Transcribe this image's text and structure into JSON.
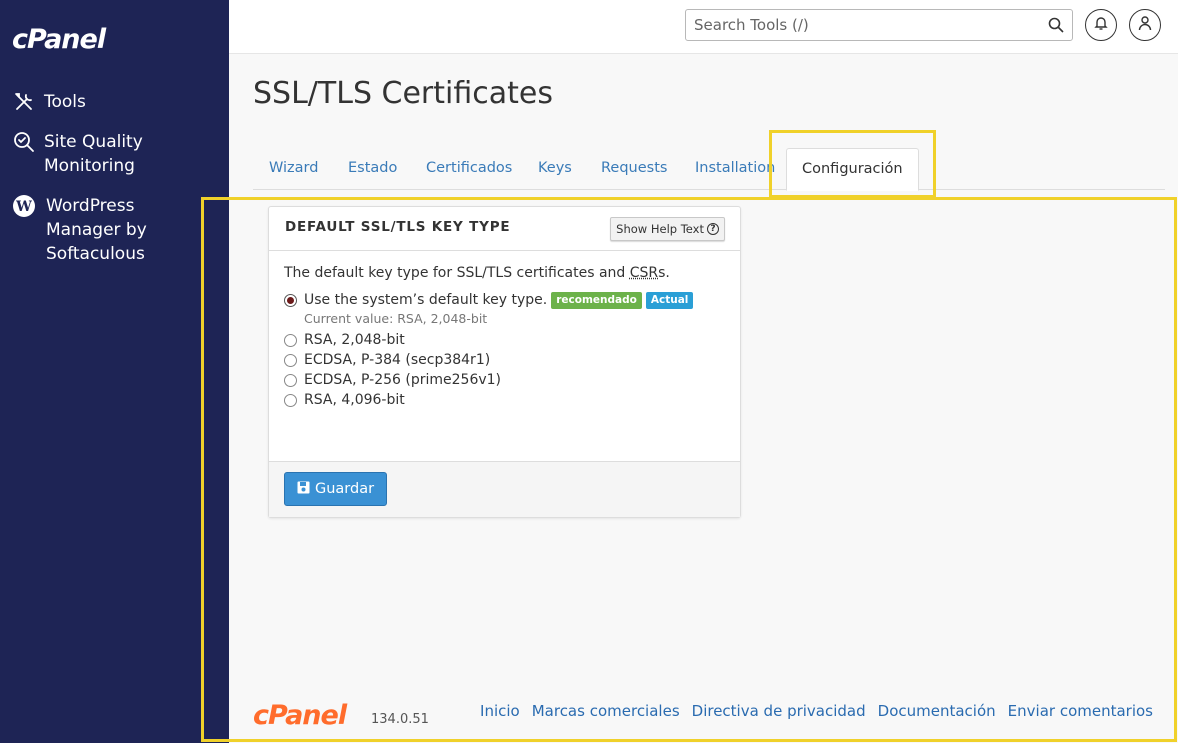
{
  "brand": {
    "logo_text": "cPanel",
    "accent": "#ff6c2c",
    "sidebar_bg": "#1e2455"
  },
  "sidebar": {
    "items": [
      {
        "label": "Tools",
        "icon": "tools-icon"
      },
      {
        "label": "Site Quality Monitoring",
        "icon": "site-quality-icon"
      },
      {
        "label": "WordPress Manager by Softaculous",
        "icon": "wordpress-icon"
      }
    ]
  },
  "header": {
    "search_placeholder": "Search Tools (/)",
    "icons": [
      "search-icon",
      "bell-icon",
      "user-icon"
    ]
  },
  "main": {
    "title": "SSL/TLS Certificates",
    "tabs": [
      {
        "label": "Wizard",
        "active": false
      },
      {
        "label": "Estado",
        "active": false
      },
      {
        "label": "Certificados",
        "active": false
      },
      {
        "label": "Keys",
        "active": false
      },
      {
        "label": "Requests",
        "active": false
      },
      {
        "label": "Installation",
        "active": false
      },
      {
        "label": "Configuración",
        "active": true
      }
    ]
  },
  "panel": {
    "title": "DEFAULT SSL/TLS KEY TYPE",
    "help_button": "Show Help Text",
    "description_prefix": "The default key type for SSL/TLS certificates and ",
    "description_abbr": "CSR",
    "description_suffix": "s.",
    "options": [
      {
        "label": "Use the system’s default key type.",
        "selected": true
      },
      {
        "label": "RSA, 2,048-bit",
        "selected": false
      },
      {
        "label": "ECDSA, P-384 (secp384r1)",
        "selected": false
      },
      {
        "label": "ECDSA, P-256 (prime256v1)",
        "selected": false
      },
      {
        "label": "RSA, 4,096-bit",
        "selected": false
      }
    ],
    "badge_recommended": "recomendado",
    "badge_current": "Actual",
    "current_value": "Current value: RSA, 2,048-bit",
    "save_button": "Guardar"
  },
  "footer": {
    "logo_text": "cPanel",
    "version": "134.0.51",
    "links": [
      "Inicio",
      "Marcas comerciales",
      "Directiva de privacidad",
      "Documentación",
      "Enviar comentarios"
    ]
  }
}
